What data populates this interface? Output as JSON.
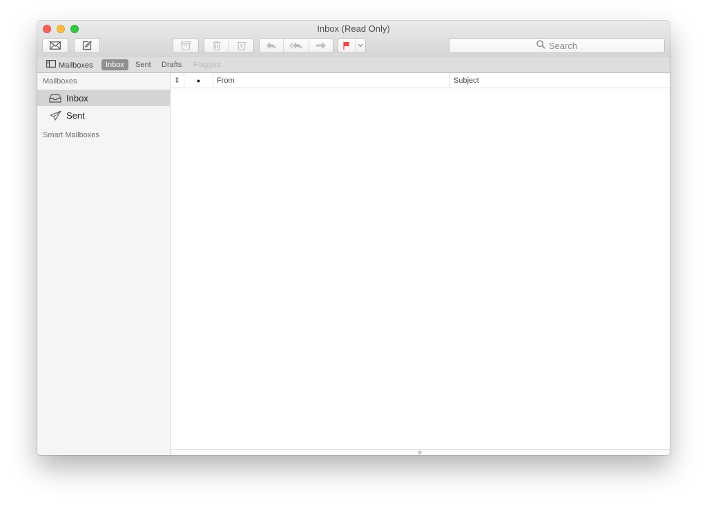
{
  "window": {
    "title": "Inbox (Read Only)"
  },
  "toolbar": {
    "icons": {
      "get_mail": "envelope-icon",
      "compose": "compose-icon",
      "archive": "archive-icon",
      "trash": "trash-icon",
      "junk": "junk-icon",
      "reply": "reply-icon",
      "reply_all": "reply-all-icon",
      "forward": "forward-icon",
      "flag": "flag-icon",
      "flag_menu": "chevron-down-icon"
    },
    "flag_color": "#f0494a"
  },
  "search": {
    "placeholder": "Search"
  },
  "favorites": {
    "mailboxes": "Mailboxes",
    "inbox": "Inbox",
    "sent": "Sent",
    "drafts": "Drafts",
    "flagged": "Flagged"
  },
  "sidebar": {
    "section_mailboxes": "Mailboxes",
    "items": [
      {
        "label": "Inbox",
        "icon": "inbox-tray-icon",
        "selected": true
      },
      {
        "label": "Sent",
        "icon": "paper-plane-icon",
        "selected": false
      }
    ],
    "section_smart": "Smart Mailboxes"
  },
  "message_list": {
    "columns": {
      "sort": "⇕",
      "unread": "●",
      "from": "From",
      "subject": "Subject"
    },
    "rows": []
  }
}
